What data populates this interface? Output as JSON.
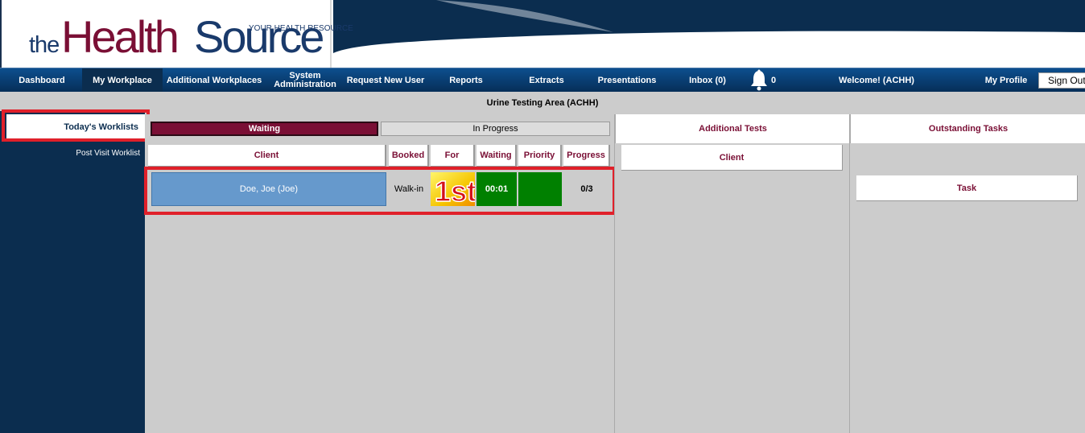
{
  "header": {
    "logo_the": "the",
    "logo_health": "Health",
    "logo_source": "Source",
    "logo_tagline": "YOUR HEALTH RESOURCE"
  },
  "nav": {
    "items": [
      {
        "label": "Dashboard"
      },
      {
        "label": "My Workplace"
      },
      {
        "label": "Additional Workplaces"
      },
      {
        "label_line1": "System",
        "label_line2": "Administration"
      },
      {
        "label": "Request New User"
      },
      {
        "label": "Reports"
      },
      {
        "label": "Extracts"
      },
      {
        "label": "Presentations"
      },
      {
        "label": "Inbox (0)"
      },
      {
        "label": "Welcome! (ACHH)"
      },
      {
        "label": "My Profile"
      }
    ],
    "active_index": 1,
    "notification_count": "0",
    "signout_label": "Sign Out"
  },
  "title": "Urine Testing Area (ACHH)",
  "sidebar": {
    "items": [
      {
        "label": "Today's Worklists"
      },
      {
        "label": "Post Visit Worklist"
      }
    ]
  },
  "worklist": {
    "tabs": [
      {
        "label": "Waiting"
      },
      {
        "label": "In Progress"
      }
    ],
    "columns": [
      "Client",
      "Booked",
      "For",
      "Waiting",
      "Priority",
      "Progress"
    ],
    "rows": [
      {
        "client": "Doe, Joe (Joe)",
        "booked": "Walk-in",
        "for_badge": "1st",
        "waiting": "00:01",
        "priority": "",
        "progress": "0/3"
      }
    ]
  },
  "additional_tests": {
    "title": "Additional Tests",
    "column": "Client"
  },
  "outstanding_tasks": {
    "title": "Outstanding Tasks",
    "column": "Task"
  },
  "colors": {
    "brand_maroon": "#7a0f35",
    "brand_navy": "#0b2d4f",
    "client_cell": "#6699cc",
    "status_green": "#008000",
    "highlight_red": "#e0202a"
  },
  "icons": {
    "bell": "bell-icon",
    "for_badge": "first-place-badge-icon"
  }
}
